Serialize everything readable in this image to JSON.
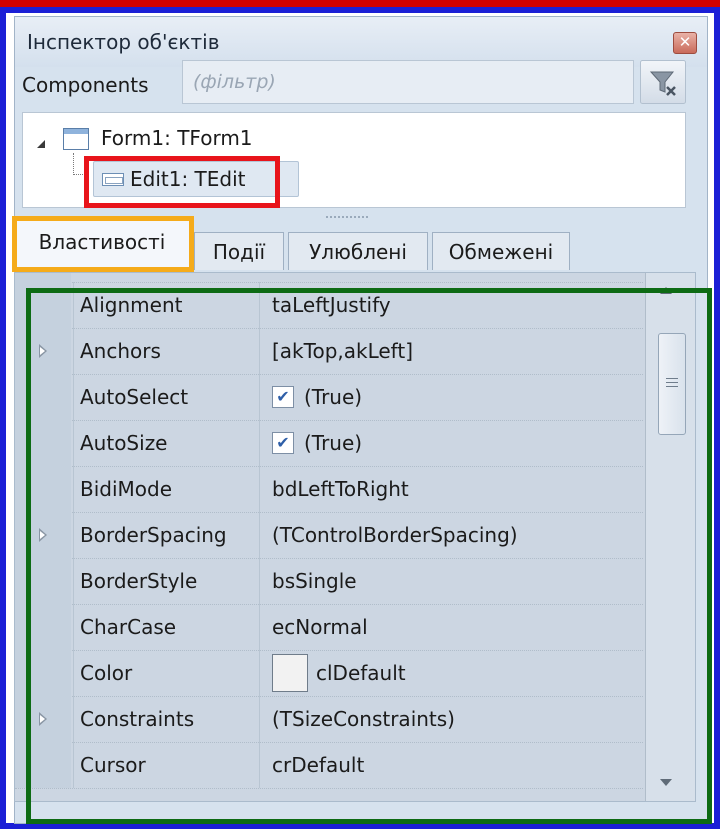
{
  "window": {
    "title": "Інспектор об'єктів"
  },
  "filter": {
    "label": "Components",
    "placeholder": "(фільтр)"
  },
  "tree": {
    "items": [
      {
        "label": "Form1: TForm1"
      },
      {
        "label": "Edit1: TEdit",
        "selected": true
      }
    ]
  },
  "tabs": [
    {
      "label": "Властивості",
      "active": true
    },
    {
      "label": "Події"
    },
    {
      "label": "Улюблені"
    },
    {
      "label": "Обмежені"
    }
  ],
  "properties": [
    {
      "name": "Alignment",
      "value": "taLeftJustify",
      "expandable": false
    },
    {
      "name": "Anchors",
      "value": "[akTop,akLeft]",
      "expandable": true
    },
    {
      "name": "AutoSelect",
      "value": "(True)",
      "expandable": false,
      "checkbox": true,
      "checked": true
    },
    {
      "name": "AutoSize",
      "value": "(True)",
      "expandable": false,
      "checkbox": true,
      "checked": true
    },
    {
      "name": "BidiMode",
      "value": "bdLeftToRight",
      "expandable": false
    },
    {
      "name": "BorderSpacing",
      "value": "(TControlBorderSpacing)",
      "expandable": true
    },
    {
      "name": "BorderStyle",
      "value": "bsSingle",
      "expandable": false
    },
    {
      "name": "CharCase",
      "value": "ecNormal",
      "expandable": false
    },
    {
      "name": "Color",
      "value": "clDefault",
      "expandable": false,
      "swatch": "#f2f2f2"
    },
    {
      "name": "Constraints",
      "value": "(TSizeConstraints)",
      "expandable": true
    },
    {
      "name": "Cursor",
      "value": "crDefault",
      "expandable": false
    }
  ],
  "colors": {
    "highlight_red": "#e8141b",
    "highlight_orange": "#f5ab1a",
    "highlight_green": "#0d6b14",
    "frame_blue": "#1b1fd6"
  }
}
